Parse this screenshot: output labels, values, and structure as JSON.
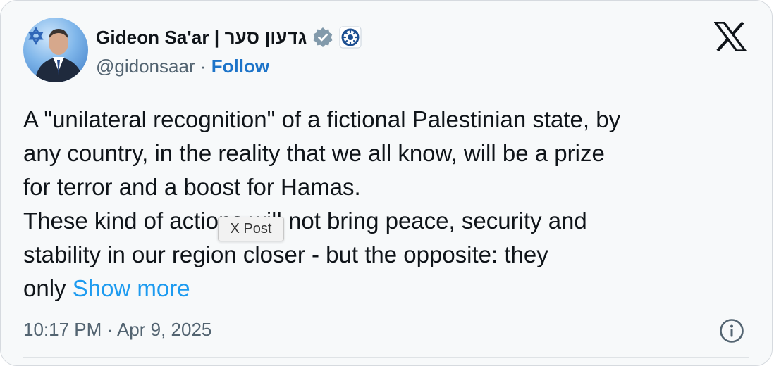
{
  "author": {
    "display_name": "Gideon Sa'ar | גדעון סער",
    "handle": "@gidonsaar",
    "separator": "·",
    "follow_label": "Follow",
    "verified_badge_color": "#829aab"
  },
  "post": {
    "lines": [
      "A \"unilateral recognition\" of a fictional Palestinian state, by",
      "any country, in the reality that we all know, will be a prize",
      "for terror and a boost for Hamas.",
      "These kind of actions will not bring peace, security and",
      "stability in our region closer - but the opposite: they",
      "only"
    ],
    "show_more_label": "Show more",
    "timestamp": "10:17 PM · Apr 9, 2025"
  },
  "tooltip": {
    "text": "X Post"
  },
  "icons": {
    "platform_logo": "x-logo-icon",
    "info": "info-icon",
    "verified": "verified-badge-icon",
    "emblem": "government-emblem-icon"
  },
  "colors": {
    "link": "#1d9bf0",
    "follow": "#1d74c9",
    "secondary_text": "#536471",
    "primary_text": "#0f1419",
    "card_background": "#f7f9fa"
  }
}
